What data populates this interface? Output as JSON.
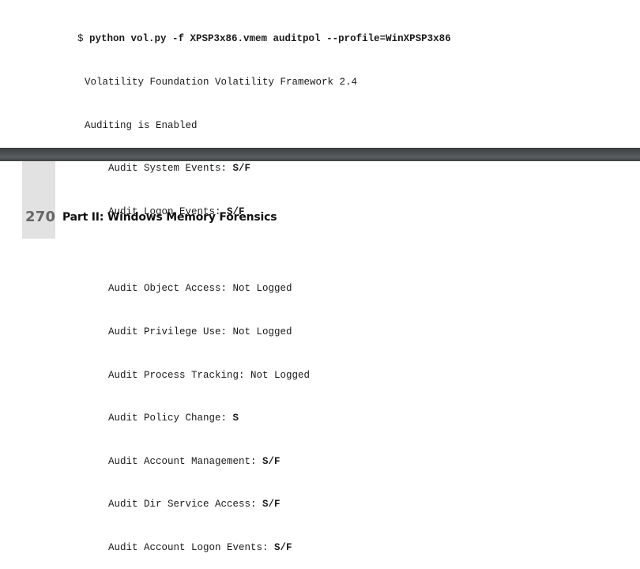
{
  "top_code": {
    "command": {
      "prompt": "$ ",
      "text": "python vol.py -f XPSP3x86.vmem auditpol --profile=WinXPSP3x86"
    },
    "lines": [
      {
        "label": "Volatility Foundation Volatility Framework 2.4",
        "value": ""
      },
      {
        "label": "Auditing is Enabled",
        "value": ""
      },
      {
        "label": "Audit System Events: ",
        "value": "S/F"
      },
      {
        "label": "Audit Logon Events: ",
        "value": "S/F"
      }
    ]
  },
  "page_header": {
    "page_number": "270",
    "title": "Part II: Windows Memory Forensics"
  },
  "bottom_code": {
    "lines": [
      {
        "label": "Audit Object Access: ",
        "value": "Not Logged"
      },
      {
        "label": "Audit Privilege Use: ",
        "value": "Not Logged"
      },
      {
        "label": "Audit Process Tracking: ",
        "value": "Not Logged"
      },
      {
        "label": "Audit Policy Change: ",
        "value": "S"
      },
      {
        "label": "Audit Account Management: ",
        "value": "S/F"
      },
      {
        "label": "Audit Dir Service Access: ",
        "value": "S/F"
      },
      {
        "label": "Audit Account Logon Events: ",
        "value": "S/F"
      }
    ]
  }
}
